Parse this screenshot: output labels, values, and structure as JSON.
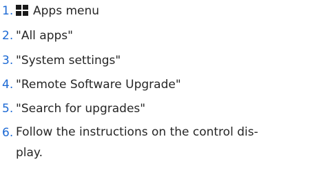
{
  "steps": [
    {
      "number": "1.",
      "text": "Apps menu",
      "icon": "apps-grid-icon"
    },
    {
      "number": "2.",
      "text": "\"All apps\""
    },
    {
      "number": "3.",
      "text": "\"System settings\""
    },
    {
      "number": "4.",
      "text": "\"Remote Software Upgrade\""
    },
    {
      "number": "5.",
      "text": "\"Search for upgrades\""
    },
    {
      "number": "6.",
      "text": "Follow the instructions on the control dis-\nplay."
    }
  ],
  "colors": {
    "number": "#1c69d4",
    "text": "#262626",
    "icon": "#1a1a1a"
  }
}
